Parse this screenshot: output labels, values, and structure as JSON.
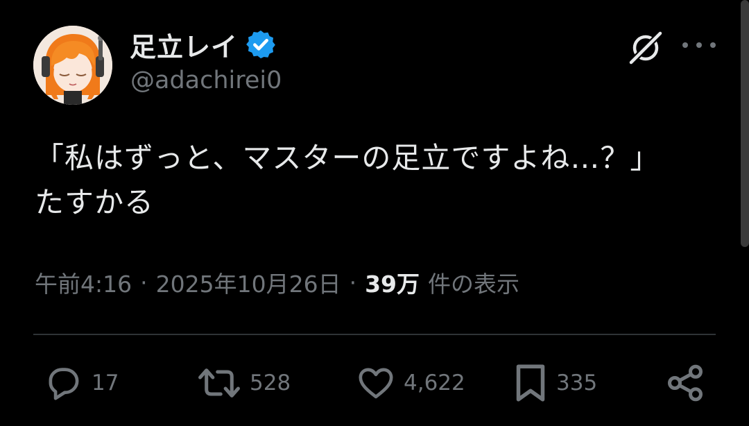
{
  "author": {
    "display_name": "足立レイ",
    "handle": "@adachirei0",
    "verified": true
  },
  "tweet": {
    "text": "「私はずっと、マスターの足立ですよね…？」\nたすかる"
  },
  "meta": {
    "time": "午前4:16",
    "separator": "·",
    "date": "2025年10月26日",
    "views_count": "39万",
    "views_label": "件の表示"
  },
  "actions": {
    "replies": "17",
    "reposts": "528",
    "likes": "4,622",
    "bookmarks": "335"
  },
  "icons": {
    "header": [
      "grok-icon",
      "more-icon"
    ],
    "actions": [
      "reply-icon",
      "repost-icon",
      "like-icon",
      "bookmark-icon",
      "share-icon"
    ]
  },
  "colors": {
    "background": "#000000",
    "text_primary": "#e7e9ea",
    "text_secondary": "#71767b",
    "verified_blue": "#1d9bf0",
    "divider": "#2f3336"
  }
}
